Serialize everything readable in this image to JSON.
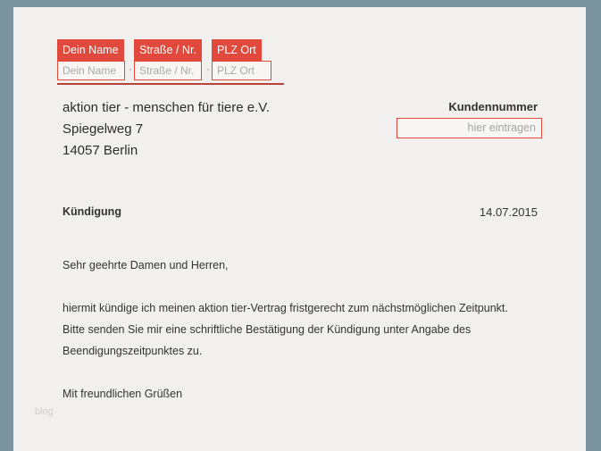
{
  "sender": {
    "name": {
      "label": "Dein Name",
      "placeholder": "Dein Name"
    },
    "street": {
      "label": "Straße / Nr.",
      "placeholder": "Straße / Nr."
    },
    "city": {
      "label": "PLZ Ort",
      "placeholder": "PLZ Ort"
    },
    "separator": "·"
  },
  "recipient": {
    "line1": "aktion tier - menschen für tiere e.V.",
    "line2": "Spiegelweg 7",
    "line3": "14057 Berlin"
  },
  "customer": {
    "label": "Kundennummer",
    "placeholder": "hier eintragen"
  },
  "letter": {
    "subject": "Kündigung",
    "date": "14.07.2015",
    "salutation": "Sehr geehrte Damen und Herren,",
    "paragraph_line1": "hiermit kündige ich meinen aktion tier-Vertrag fristgerecht zum nächstmöglichen Zeitpunkt.",
    "paragraph_line2": "Bitte senden Sie mir eine schriftliche Bestätigung der Kündigung unter Angabe des",
    "paragraph_line3": "Beendigungszeitpunktes zu.",
    "closing": "Mit freundlichen Grüßen"
  },
  "watermark": "blog",
  "colors": {
    "accent": "#e0493c",
    "background": "#7b939e",
    "paper": "#f1f0ef"
  }
}
